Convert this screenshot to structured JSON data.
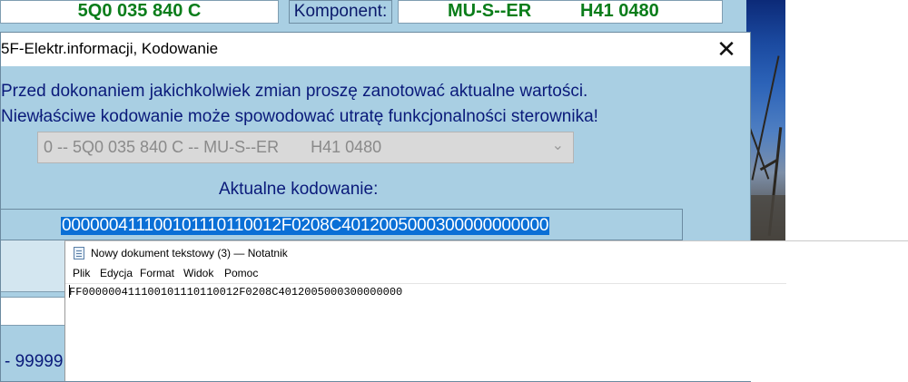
{
  "background_app": {
    "part_number": "5Q0 035 840 C",
    "komponent_label": "Komponent:",
    "komponent_name": "MU-S--ER",
    "komponent_version": "H41 0480"
  },
  "dialog": {
    "title": "5F-Elektr.informacji,  Kodowanie",
    "close_glyph": "✕",
    "warning_line1": "Przed dokonaniem jakichkolwiek zmian proszę zanotować aktualne wartości.",
    "warning_line2": "Niewłaściwe kodowanie może spowodować utratę funkcjonalności sterownika!",
    "module_select": {
      "selected": "0 -- 5Q0 035 840 C -- MU-S--ER       H41 0480",
      "arrow_glyph": "⌄"
    },
    "coding_label": "Aktualne kodowanie:",
    "coding_value": "000000411100101110110012F0208C4012005000300000000000",
    "range_text": "- 99999"
  },
  "notepad": {
    "title": "Nowy dokument tekstowy (3) — Notatnik",
    "menu": [
      "Plik",
      "Edycja",
      "Format",
      "Widok",
      "Pomoc"
    ],
    "content": "FF000000411100101110110012F0208C4012005000300000000"
  },
  "colors": {
    "app_background": "#a9cfe3",
    "value_green": "#0a7d1a",
    "label_navy": "#0a1a7a",
    "selection_blue": "#0a6fd6"
  }
}
